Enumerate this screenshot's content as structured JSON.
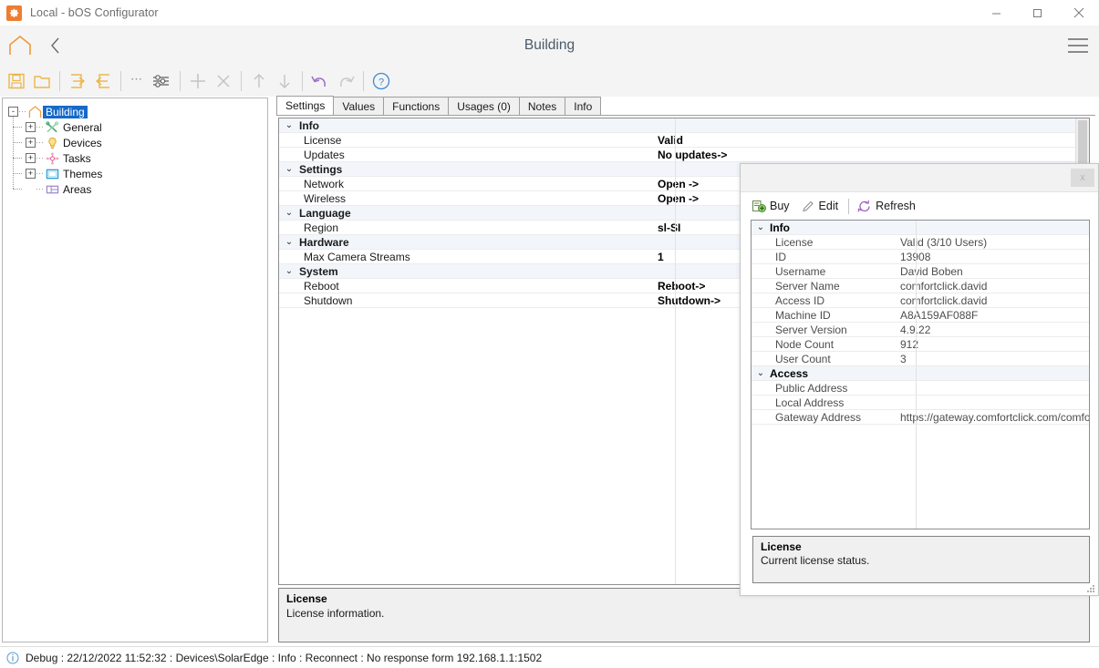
{
  "window": {
    "title": "Local - bOS Configurator",
    "app_icon": "gear-icon",
    "accent": "#ED7D31",
    "minimize": "minimize-icon",
    "maximize": "maximize-icon",
    "close": "close-icon"
  },
  "header": {
    "home_icon": "home-icon",
    "back_icon": "chevron-left-icon",
    "title": "Building",
    "menu_icon": "hamburger-menu-icon"
  },
  "toolbar": {
    "items": [
      {
        "name": "save-button",
        "icon": "floppy-disk-icon"
      },
      {
        "name": "open-button",
        "icon": "folder-icon"
      },
      {
        "name": "export-button",
        "icon": "arrow-into-box-icon"
      },
      {
        "name": "import-button",
        "icon": "arrow-out-of-box-icon"
      },
      {
        "name": "more-options-button",
        "icon": "ellipsis-icon"
      },
      {
        "name": "settings-sliders-button",
        "icon": "sliders-icon"
      },
      {
        "name": "add-button",
        "icon": "plus-icon"
      },
      {
        "name": "delete-button",
        "icon": "cross-icon"
      },
      {
        "name": "move-up-button",
        "icon": "arrow-up-icon"
      },
      {
        "name": "move-down-button",
        "icon": "arrow-down-icon"
      },
      {
        "name": "undo-button",
        "icon": "undo-arrow-icon"
      },
      {
        "name": "redo-button",
        "icon": "redo-arrow-icon"
      },
      {
        "name": "help-button",
        "icon": "question-mark-circle-icon"
      }
    ]
  },
  "tree": {
    "root": {
      "label": "Building",
      "icon": "house-icon",
      "selected": true,
      "expander": "-"
    },
    "children": [
      {
        "label": "General",
        "icon": "tools-icon",
        "expander": "+"
      },
      {
        "label": "Devices",
        "icon": "lightbulb-icon",
        "expander": "+"
      },
      {
        "label": "Tasks",
        "icon": "task-node-icon",
        "expander": "+"
      },
      {
        "label": "Themes",
        "icon": "theme-frame-icon",
        "expander": "+"
      },
      {
        "label": "Areas",
        "icon": "areas-plan-icon",
        "expander": ""
      }
    ]
  },
  "tabs": [
    {
      "label": "Settings",
      "active": true
    },
    {
      "label": "Values",
      "active": false
    },
    {
      "label": "Functions",
      "active": false
    },
    {
      "label": "Usages (0)",
      "active": false
    },
    {
      "label": "Notes",
      "active": false
    },
    {
      "label": "Info",
      "active": false
    }
  ],
  "settings_grid": {
    "rows": [
      {
        "type": "category",
        "name": "Info",
        "value": "",
        "chevron": "⌄"
      },
      {
        "type": "item",
        "name": "License",
        "value": "Valid"
      },
      {
        "type": "item",
        "name": "Updates",
        "value": "No updates->"
      },
      {
        "type": "category",
        "name": "Settings",
        "value": "",
        "chevron": "⌄"
      },
      {
        "type": "item",
        "name": "Network",
        "value": "Open ->"
      },
      {
        "type": "item",
        "name": "Wireless",
        "value": "Open ->"
      },
      {
        "type": "category",
        "name": "Language",
        "value": "",
        "chevron": "⌄"
      },
      {
        "type": "item",
        "name": "Region",
        "value": "sl-SI"
      },
      {
        "type": "category",
        "name": "Hardware",
        "value": "",
        "chevron": "⌄"
      },
      {
        "type": "item",
        "name": "Max Camera Streams",
        "value": "1"
      },
      {
        "type": "category",
        "name": "System",
        "value": "",
        "chevron": "⌄"
      },
      {
        "type": "item",
        "name": "Reboot",
        "value": "Reboot->"
      },
      {
        "type": "item",
        "name": "Shutdown",
        "value": "Shutdown->"
      }
    ]
  },
  "main_description": {
    "title": "License",
    "text": "License information."
  },
  "dialog": {
    "title": "",
    "close_label": "x",
    "tools": [
      {
        "label": "Buy",
        "icon": "buy-cart-icon",
        "color": "#6fb23a"
      },
      {
        "label": "Edit",
        "icon": "pencil-icon",
        "color": "#8f8f8f"
      },
      {
        "label": "Refresh",
        "icon": "refresh-circular-arrow-icon",
        "color": "#a05fc0"
      }
    ],
    "grid": {
      "rows": [
        {
          "type": "category",
          "name": "Info",
          "value": "",
          "chevron": "⌄"
        },
        {
          "type": "item",
          "name": "License",
          "value": "Valid (3/10 Users)"
        },
        {
          "type": "item",
          "name": "ID",
          "value": "13908"
        },
        {
          "type": "item",
          "name": "Username",
          "value": "David Boben"
        },
        {
          "type": "item",
          "name": "Server Name",
          "value": "comfortclick.david"
        },
        {
          "type": "item",
          "name": "Access ID",
          "value": "comfortclick.david"
        },
        {
          "type": "item",
          "name": "Machine ID",
          "value": "A8A159AF088F"
        },
        {
          "type": "item",
          "name": "Server Version",
          "value": "4.9.22"
        },
        {
          "type": "item",
          "name": "Node Count",
          "value": "912"
        },
        {
          "type": "item",
          "name": "User Count",
          "value": "3"
        },
        {
          "type": "category",
          "name": "Access",
          "value": "",
          "chevron": "⌄"
        },
        {
          "type": "item",
          "name": "Public Address",
          "value": ""
        },
        {
          "type": "item",
          "name": "Local Address",
          "value": ""
        },
        {
          "type": "item",
          "name": "Gateway Address",
          "value": "https://gateway.comfortclick.com/comfo"
        }
      ]
    },
    "description": {
      "title": "License",
      "text": "Current license status."
    }
  },
  "statusbar": {
    "icon": "info-circle-icon",
    "text": "Debug : 22/12/2022 11:52:32 : Devices\\SolarEdge : Info : Reconnect : No response form 192.168.1.1:1502"
  }
}
